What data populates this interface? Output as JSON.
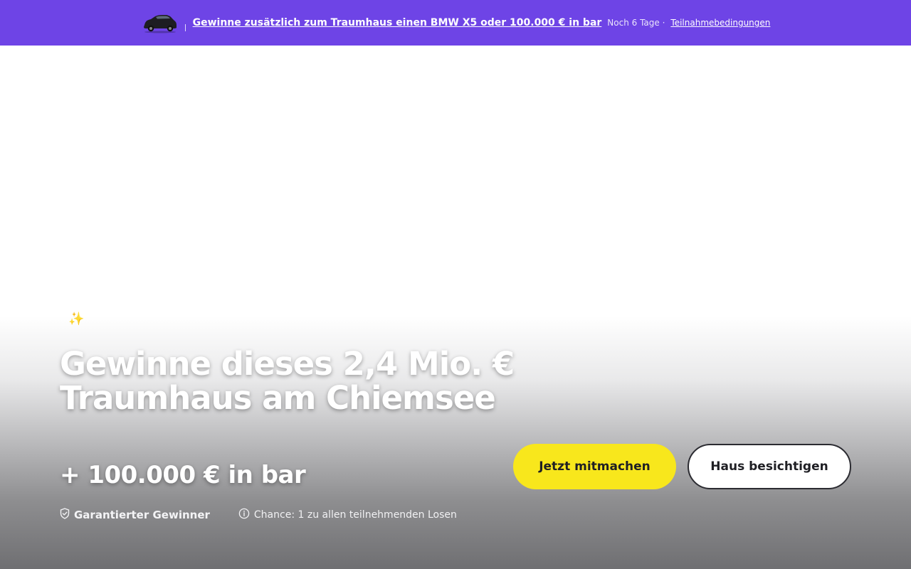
{
  "banner": {
    "car_image_icon": "bmw-x5-car-thumbnail",
    "main_text": "Gewinne zusätzlich zum Traumhaus einen BMW X5 oder 100.000 € in bar",
    "countdown": "Noch 6 Tage ·",
    "terms_link": "Teilnahmebedingungen",
    "background_color": "#6e44e6"
  },
  "hero": {
    "sparkle_icon": "sparkles-icon",
    "title": "Gewinne dieses 2,4 Mio. € Traumhaus am Chiemsee",
    "subtitle": "+ 100.000 € in bar",
    "guarantee_icon": "shield-check-icon",
    "guarantee_text": "Garantierter Gewinner",
    "info_icon": "info-circle-icon",
    "chance_text": "Chance: 1 zu allen teilnehmenden Losen",
    "primary_button": "Jetzt mitmachen",
    "secondary_button": "Haus besichtigen",
    "primary_button_color": "#f8e71c"
  }
}
